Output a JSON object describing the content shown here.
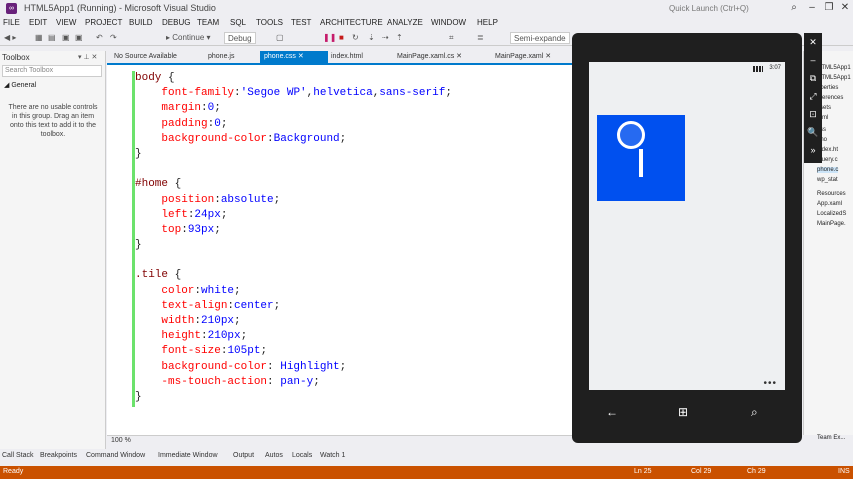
{
  "window": {
    "title": "HTML5App1 (Running) - Microsoft Visual Studio",
    "quick_launch_placeholder": "Quick Launch (Ctrl+Q)",
    "controls": {
      "minimize": "–",
      "maximize": "❐",
      "close": "✕"
    }
  },
  "menu": [
    "FILE",
    "EDIT",
    "VIEW",
    "PROJECT",
    "BUILD",
    "DEBUG",
    "TEAM",
    "SQL",
    "TOOLS",
    "TEST",
    "ARCHITECTURE",
    "ANALYZE",
    "WINDOW",
    "HELP"
  ],
  "toolbar": {
    "continue_label": "▸ Continue ▾",
    "config_label": "Debug",
    "layout_dropdown": "Semi-expande"
  },
  "toolbox": {
    "title": "Toolbox",
    "search_placeholder": "Search Toolbox",
    "group": "◢ General",
    "empty_text": "There are no usable controls in this group. Drag an item onto this text to add it to the toolbox."
  },
  "tabs": [
    {
      "label": "No Source Available"
    },
    {
      "label": "phone.js"
    },
    {
      "label": "phone.css ✕",
      "active": true
    },
    {
      "label": "index.html"
    },
    {
      "label": "MainPage.xaml.cs ✕"
    },
    {
      "label": "MainPage.xaml ✕"
    }
  ],
  "code_lines": [
    [
      [
        "sel",
        "body"
      ],
      [
        "pun",
        " {"
      ]
    ],
    [
      [
        "pun",
        "    "
      ],
      [
        "prop",
        "font-family"
      ],
      [
        "pun",
        ":"
      ],
      [
        "val",
        "'Segoe WP'"
      ],
      [
        "pun",
        ","
      ],
      [
        "val",
        "helvetica"
      ],
      [
        "pun",
        ","
      ],
      [
        "val",
        "sans-serif"
      ],
      [
        "pun",
        ";"
      ]
    ],
    [
      [
        "pun",
        "    "
      ],
      [
        "prop",
        "margin"
      ],
      [
        "pun",
        ":"
      ],
      [
        "val",
        "0"
      ],
      [
        "pun",
        ";"
      ]
    ],
    [
      [
        "pun",
        "    "
      ],
      [
        "prop",
        "padding"
      ],
      [
        "pun",
        ":"
      ],
      [
        "val",
        "0"
      ],
      [
        "pun",
        ";"
      ]
    ],
    [
      [
        "pun",
        "    "
      ],
      [
        "prop",
        "background-color"
      ],
      [
        "pun",
        ":"
      ],
      [
        "val",
        "Background"
      ],
      [
        "pun",
        ";"
      ]
    ],
    [
      [
        "pun",
        "}"
      ]
    ],
    [
      [
        "pun",
        ""
      ]
    ],
    [
      [
        "sel",
        "#home"
      ],
      [
        "pun",
        " {"
      ]
    ],
    [
      [
        "pun",
        "    "
      ],
      [
        "prop",
        "position"
      ],
      [
        "pun",
        ":"
      ],
      [
        "val",
        "absolute"
      ],
      [
        "pun",
        ";"
      ]
    ],
    [
      [
        "pun",
        "    "
      ],
      [
        "prop",
        "left"
      ],
      [
        "pun",
        ":"
      ],
      [
        "val",
        "24px"
      ],
      [
        "pun",
        ";"
      ]
    ],
    [
      [
        "pun",
        "    "
      ],
      [
        "prop",
        "top"
      ],
      [
        "pun",
        ":"
      ],
      [
        "val",
        "93px"
      ],
      [
        "pun",
        ";"
      ]
    ],
    [
      [
        "pun",
        "}"
      ]
    ],
    [
      [
        "pun",
        ""
      ]
    ],
    [
      [
        "sel",
        ".tile"
      ],
      [
        "pun",
        " {"
      ]
    ],
    [
      [
        "pun",
        "    "
      ],
      [
        "prop",
        "color"
      ],
      [
        "pun",
        ":"
      ],
      [
        "val",
        "white"
      ],
      [
        "pun",
        ";"
      ]
    ],
    [
      [
        "pun",
        "    "
      ],
      [
        "prop",
        "text-align"
      ],
      [
        "pun",
        ":"
      ],
      [
        "val",
        "center"
      ],
      [
        "pun",
        ";"
      ]
    ],
    [
      [
        "pun",
        "    "
      ],
      [
        "prop",
        "width"
      ],
      [
        "pun",
        ":"
      ],
      [
        "val",
        "210px"
      ],
      [
        "pun",
        ";"
      ]
    ],
    [
      [
        "pun",
        "    "
      ],
      [
        "prop",
        "height"
      ],
      [
        "pun",
        ":"
      ],
      [
        "val",
        "210px"
      ],
      [
        "pun",
        ";"
      ]
    ],
    [
      [
        "pun",
        "    "
      ],
      [
        "prop",
        "font-size"
      ],
      [
        "pun",
        ":"
      ],
      [
        "val",
        "105pt"
      ],
      [
        "pun",
        ";"
      ]
    ],
    [
      [
        "pun",
        "    "
      ],
      [
        "prop",
        "background-color"
      ],
      [
        "pun",
        ": "
      ],
      [
        "val",
        "Highlight"
      ],
      [
        "pun",
        ";"
      ]
    ],
    [
      [
        "pun",
        "    "
      ],
      [
        "prop",
        "-ms-touch-action"
      ],
      [
        "pun",
        ": "
      ],
      [
        "val",
        "pan-y"
      ],
      [
        "pun",
        ";"
      ]
    ],
    [
      [
        "pun",
        "}"
      ]
    ]
  ],
  "zoom": "100 %",
  "bottom_tabs": [
    "Call Stack",
    "Breakpoints",
    "Command Window",
    "Immediate Window",
    "Output",
    "Autos",
    "Locals",
    "Watch 1"
  ],
  "status": {
    "left": "Ready",
    "ln": "Ln 25",
    "col": "Col 29",
    "ch": "Ch 29",
    "ins": "INS"
  },
  "solution_items": [
    {
      "label": "HTML5App1"
    },
    {
      "label": "HTML5App1"
    },
    {
      "label": "operties"
    },
    {
      "label": "eferences"
    },
    {
      "label": "ssets"
    },
    {
      "label": "html"
    },
    {
      "label": "css"
    },
    {
      "label": "pho"
    },
    {
      "label": "index.ht"
    },
    {
      "label": "jquery.c"
    },
    {
      "label": "phone.c",
      "highlight": true
    },
    {
      "label": "wp_stat"
    },
    {
      "label": "Resources"
    },
    {
      "label": "App.xaml"
    },
    {
      "label": "LocalizedS"
    },
    {
      "label": "MainPage."
    }
  ],
  "team_explorer": "Team Ex...",
  "emulator": {
    "time": "3:07",
    "tile_color": "#0050ef",
    "appbar_dots": "•••",
    "back": "←",
    "start": "⊞",
    "search": "⌕",
    "tools": [
      "✕",
      "–",
      "⧉",
      "⤢",
      "⊡",
      "🔍",
      "»"
    ]
  }
}
